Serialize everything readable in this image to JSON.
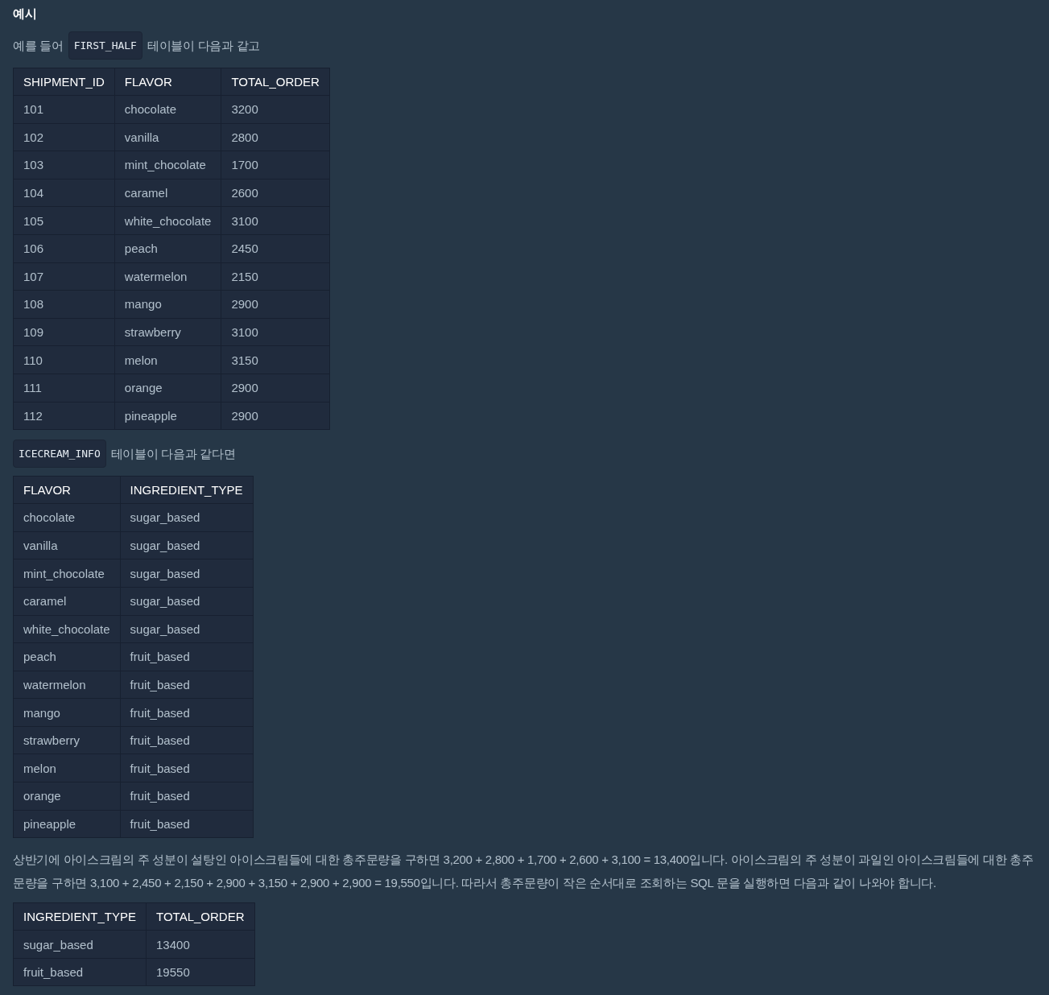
{
  "heading": "예시",
  "blocks": [
    {
      "kind": "paragraph",
      "segments": [
        {
          "kind": "text",
          "text": "예를 들어"
        },
        {
          "kind": "code",
          "text": "FIRST_HALF"
        },
        {
          "kind": "text",
          "text": "테이블이 다음과 같고"
        }
      ]
    },
    {
      "kind": "table",
      "columns": [
        "SHIPMENT_ID",
        "FLAVOR",
        "TOTAL_ORDER"
      ],
      "rows": [
        [
          "101",
          "chocolate",
          "3200"
        ],
        [
          "102",
          "vanilla",
          "2800"
        ],
        [
          "103",
          "mint_chocolate",
          "1700"
        ],
        [
          "104",
          "caramel",
          "2600"
        ],
        [
          "105",
          "white_chocolate",
          "3100"
        ],
        [
          "106",
          "peach",
          "2450"
        ],
        [
          "107",
          "watermelon",
          "2150"
        ],
        [
          "108",
          "mango",
          "2900"
        ],
        [
          "109",
          "strawberry",
          "3100"
        ],
        [
          "110",
          "melon",
          "3150"
        ],
        [
          "111",
          "orange",
          "2900"
        ],
        [
          "112",
          "pineapple",
          "2900"
        ]
      ]
    },
    {
      "kind": "paragraph",
      "segments": [
        {
          "kind": "code",
          "text": "ICECREAM_INFO"
        },
        {
          "kind": "text",
          "text": "테이블이 다음과 같다면"
        }
      ]
    },
    {
      "kind": "table",
      "columns": [
        "FLAVOR",
        "INGREDIENT_TYPE"
      ],
      "rows": [
        [
          "chocolate",
          "sugar_based"
        ],
        [
          "vanilla",
          "sugar_based"
        ],
        [
          "mint_chocolate",
          "sugar_based"
        ],
        [
          "caramel",
          "sugar_based"
        ],
        [
          "white_chocolate",
          "sugar_based"
        ],
        [
          "peach",
          "fruit_based"
        ],
        [
          "watermelon",
          "fruit_based"
        ],
        [
          "mango",
          "fruit_based"
        ],
        [
          "strawberry",
          "fruit_based"
        ],
        [
          "melon",
          "fruit_based"
        ],
        [
          "orange",
          "fruit_based"
        ],
        [
          "pineapple",
          "fruit_based"
        ]
      ]
    },
    {
      "kind": "paragraph",
      "segments": [
        {
          "kind": "text",
          "text": "상반기에 아이스크림의 주 성분이 설탕인 아이스크림들에 대한 총주문량을 구하면 3,200 + 2,800 + 1,700 + 2,600 + 3,100 = 13,400입니다. 아이스크림의 주 성분이 과일인 아이스크림들에 대한 총주문량을 구하면 3,100 + 2,450 + 2,150 + 2,900 + 3,150 + 2,900 + 2,900 = 19,550입니다. 따라서 총주문량이 작은 순서대로 조회하는 SQL 문을 실행하면 다음과 같이 나와야 합니다."
        }
      ]
    },
    {
      "kind": "table",
      "columns": [
        "INGREDIENT_TYPE",
        "TOTAL_ORDER"
      ],
      "rows": [
        [
          "sugar_based",
          "13400"
        ],
        [
          "fruit_based",
          "19550"
        ]
      ]
    }
  ]
}
